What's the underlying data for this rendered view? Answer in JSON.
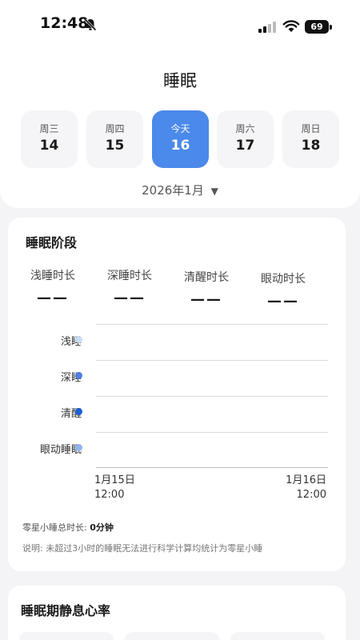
{
  "status_bar": {
    "time": "12:48",
    "battery": "69",
    "icons": [
      "bell-slash-icon",
      "cellular-signal-icon",
      "wifi-icon",
      "battery-icon"
    ]
  },
  "header": {
    "title": "睡眠",
    "days": [
      {
        "weekday": "周三",
        "date": "14",
        "selected": false
      },
      {
        "weekday": "周四",
        "date": "15",
        "selected": false
      },
      {
        "weekday": "今天",
        "date": "16",
        "selected": true
      },
      {
        "weekday": "周六",
        "date": "17",
        "selected": false
      },
      {
        "weekday": "周日",
        "date": "18",
        "selected": false
      }
    ],
    "month": "2026年1月",
    "month_caret": "▼"
  },
  "stages_card": {
    "title": "睡眠阶段",
    "stats": [
      {
        "label": "浅睡时长",
        "value": "——"
      },
      {
        "label": "深睡时长",
        "value": "——"
      },
      {
        "label": "清醒时长",
        "value": "——"
      },
      {
        "label": "眼动时长",
        "value": "——"
      }
    ],
    "stages": [
      {
        "label": "浅睡",
        "color": "#c9dcf5"
      },
      {
        "label": "深睡",
        "color": "#4f7fe0"
      },
      {
        "label": "清醒",
        "color": "#1e5fd6"
      },
      {
        "label": "眼动睡眠",
        "color": "#8eb4ee"
      }
    ],
    "x_start": {
      "date": "1月15日",
      "time": "12:00"
    },
    "x_end": {
      "date": "1月16日",
      "time": "12:00"
    },
    "nap_label": "零星小睡总时长:",
    "nap_value": "0分钟",
    "note": "说明: 未超过3小时的睡眠无法进行科学计算均统计为零星小睡"
  },
  "heart_card": {
    "title": "睡眠期静息心率"
  },
  "colors": {
    "accent": "#4b89ea",
    "page_bg": "#f4f4f6"
  }
}
